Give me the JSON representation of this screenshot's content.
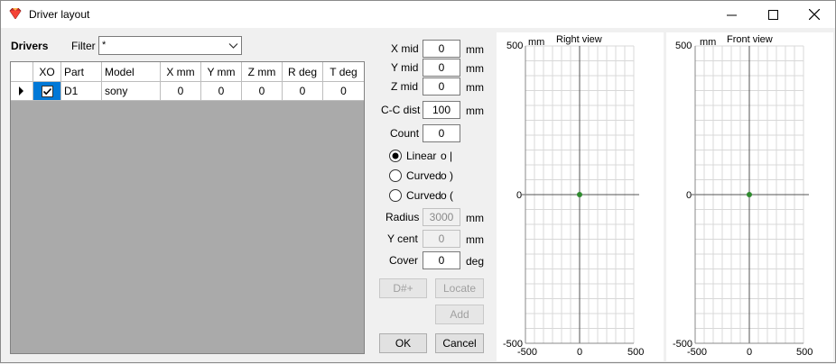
{
  "window": {
    "title": "Driver layout",
    "min_label": "Minimize",
    "max_label": "Maximize",
    "close_label": "Close"
  },
  "drivers": {
    "heading": "Drivers",
    "filter_label": "Filter",
    "filter_value": "*",
    "columns": [
      "XO",
      "Part",
      "Model",
      "X mm",
      "Y mm",
      "Z mm",
      "R deg",
      "T deg"
    ],
    "rows": [
      {
        "xo": true,
        "part": "D1",
        "model": "sony",
        "x": "0",
        "y": "0",
        "z": "0",
        "r": "0",
        "t": "0"
      }
    ]
  },
  "params": {
    "x_mid_label": "X mid",
    "x_mid": "0",
    "x_mid_unit": "mm",
    "y_mid_label": "Y mid",
    "y_mid": "0",
    "y_mid_unit": "mm",
    "z_mid_label": "Z mid",
    "z_mid": "0",
    "z_mid_unit": "mm",
    "cc_dist_label": "C-C dist",
    "cc_dist": "100",
    "cc_dist_unit": "mm",
    "count_label": "Count",
    "count": "0",
    "layout_options": [
      {
        "label": "Linear",
        "glyph": "o |",
        "selected": true
      },
      {
        "label": "Curved",
        "glyph": "o )",
        "selected": false
      },
      {
        "label": "Curved",
        "glyph": "o (",
        "selected": false
      }
    ],
    "radius_label": "Radius",
    "radius": "3000",
    "radius_unit": "mm",
    "y_cent_label": "Y cent",
    "y_cent": "0",
    "y_cent_unit": "mm",
    "cover_label": "Cover",
    "cover": "0",
    "cover_unit": "deg"
  },
  "buttons": {
    "dnum": "D#+",
    "locate": "Locate",
    "add": "Add",
    "ok": "OK",
    "cancel": "Cancel"
  },
  "views": [
    {
      "title": "Right view",
      "unit": "mm",
      "y_max": "500",
      "y_mid": "0",
      "y_min": "-500",
      "x_min": "-500",
      "x_mid": "0",
      "x_max": "500",
      "point_x": 0,
      "point_y": 0
    },
    {
      "title": "Front view",
      "unit": "mm",
      "y_max": "500",
      "y_mid": "0",
      "y_min": "-500",
      "x_min": "-500",
      "x_mid": "0",
      "x_max": "500",
      "point_x": 0,
      "point_y": 0
    }
  ],
  "colors": {
    "point": "#2e8b2e",
    "selection": "#0078d7",
    "grid_bg": "#aaaaaa"
  }
}
